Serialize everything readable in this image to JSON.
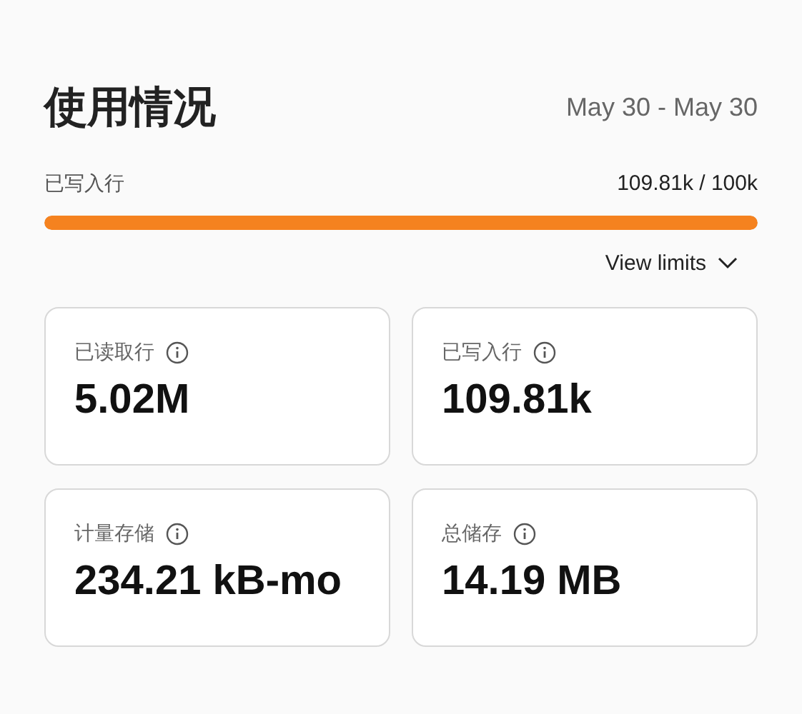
{
  "header": {
    "title": "使用情况",
    "date_range": "May 30 - May 30"
  },
  "usage": {
    "label": "已写入行",
    "reading": "109.81k / 100k",
    "level": 1
  },
  "view_limits": {
    "label": "View limits",
    "expanded": false
  },
  "metrics": [
    {
      "label": "已读取行",
      "value": "5.02M"
    },
    {
      "label": "已写入行",
      "value": "109.81k"
    },
    {
      "label": "计量存储",
      "value": "234.21 kB-mo"
    },
    {
      "label": "总储存",
      "value": "14.19 MB"
    }
  ]
}
